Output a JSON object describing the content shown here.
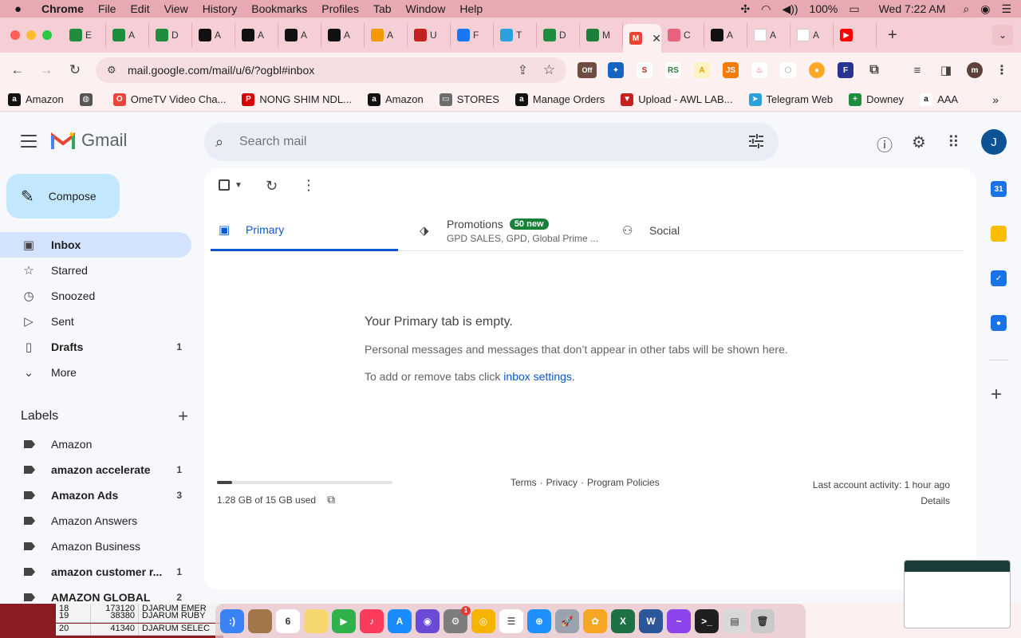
{
  "menubar": {
    "apple": "",
    "items": [
      "Chrome",
      "File",
      "Edit",
      "View",
      "History",
      "Bookmarks",
      "Profiles",
      "Tab",
      "Window",
      "Help"
    ],
    "battery": "100%",
    "clock": "Wed 7:22 AM"
  },
  "tabs": [
    {
      "label": "E",
      "color": "#1e8e3e"
    },
    {
      "label": "A",
      "color": "#1e8e3e"
    },
    {
      "label": "D",
      "color": "#1e8e3e"
    },
    {
      "label": "A",
      "color": "#111111"
    },
    {
      "label": "A",
      "color": "#111111"
    },
    {
      "label": "A",
      "color": "#111111"
    },
    {
      "label": "A",
      "color": "#111111"
    },
    {
      "label": "A",
      "color": "#f29900"
    },
    {
      "label": "U",
      "color": "#c5221f"
    },
    {
      "label": "F",
      "color": "#1877f2"
    },
    {
      "label": "T",
      "color": "#2aa1da"
    },
    {
      "label": "D",
      "color": "#1e8e3e"
    },
    {
      "label": "M",
      "color": "#188038"
    },
    {
      "label": "",
      "color": "#ea4335",
      "active": true
    },
    {
      "label": "C",
      "color": "#e8637b"
    },
    {
      "label": "A",
      "color": "#111111"
    },
    {
      "label": "A",
      "color": "#ffffff"
    },
    {
      "label": "A",
      "color": "#ffffff"
    },
    {
      "label": "",
      "color": "#ff0000"
    }
  ],
  "toolbar": {
    "url": "mail.google.com/mail/u/6/?ogbl#inbox",
    "off_badge": "Off",
    "profile_initial": "m"
  },
  "bookmarks": [
    {
      "label": "Amazon",
      "color": "#111111",
      "glyph": "a"
    },
    {
      "label": "",
      "color": "#555555",
      "glyph": "◍"
    },
    {
      "label": "OmeTV Video Cha...",
      "color": "#e8453c",
      "glyph": "O"
    },
    {
      "label": "NONG SHIM NDL...",
      "color": "#d50000",
      "glyph": "P"
    },
    {
      "label": "Amazon",
      "color": "#111111",
      "glyph": "a"
    },
    {
      "label": "STORES",
      "color": "#6d6d6d",
      "glyph": "▭"
    },
    {
      "label": "Manage Orders",
      "color": "#111111",
      "glyph": "a"
    },
    {
      "label": "Upload - AWL LAB...",
      "color": "#c5221f",
      "glyph": "▼"
    },
    {
      "label": "Telegram Web",
      "color": "#2aa1da",
      "glyph": "➤"
    },
    {
      "label": "Downey",
      "color": "#1e8e3e",
      "glyph": "+"
    },
    {
      "label": "AAA",
      "color": "#ffffff",
      "glyph": "a"
    }
  ],
  "gmail": {
    "wordmark": "Gmail",
    "search_placeholder": "Search mail",
    "avatar_initial": "J",
    "compose": "Compose",
    "nav": [
      {
        "label": "Inbox",
        "icon": "inbox-icon",
        "glyph": "▣",
        "count": "",
        "active": true
      },
      {
        "label": "Starred",
        "icon": "star-icon",
        "glyph": "☆",
        "count": ""
      },
      {
        "label": "Snoozed",
        "icon": "clock-icon",
        "glyph": "◷",
        "count": ""
      },
      {
        "label": "Sent",
        "icon": "send-icon",
        "glyph": "▷",
        "count": ""
      },
      {
        "label": "Drafts",
        "icon": "draft-icon",
        "glyph": "▯",
        "count": "1",
        "bold": true
      },
      {
        "label": "More",
        "icon": "chevron-down-icon",
        "glyph": "⌄",
        "count": ""
      }
    ],
    "labels_title": "Labels",
    "labels": [
      {
        "label": "Amazon",
        "count": "",
        "bold": false
      },
      {
        "label": "amazon accelerate",
        "count": "1",
        "bold": true
      },
      {
        "label": "Amazon Ads",
        "count": "3",
        "bold": true
      },
      {
        "label": "Amazon Answers",
        "count": "",
        "bold": false
      },
      {
        "label": "Amazon Business",
        "count": "",
        "bold": false
      },
      {
        "label": "amazon customer r...",
        "count": "1",
        "bold": true
      },
      {
        "label": "AMAZON GLOBAL",
        "count": "2",
        "bold": true
      }
    ],
    "tabs": {
      "primary": "Primary",
      "promotions": "Promotions",
      "promotions_badge": "50 new",
      "promotions_snippet": "GPD SALES, GPD, Global Prime ...",
      "social": "Social"
    },
    "empty": {
      "title": "Your Primary tab is empty.",
      "line1": "Personal messages and messages that don’t appear in other tabs will be shown here.",
      "line2_prefix": "To add or remove tabs click ",
      "line2_link": "inbox settings",
      "line2_suffix": "."
    },
    "storage": {
      "text": "1.28 GB of 15 GB used",
      "fraction": 0.085
    },
    "footer": {
      "terms": "Terms",
      "privacy": "Privacy",
      "policies": "Program Policies",
      "sep": "·"
    },
    "activity": {
      "line": "Last account activity: 1 hour ago",
      "details": "Details"
    }
  },
  "siderail": [
    {
      "name": "calendar-icon",
      "label": "31",
      "color": "#1a73e8"
    },
    {
      "name": "keep-icon",
      "label": "",
      "color": "#fbbc04"
    },
    {
      "name": "tasks-icon",
      "label": "✓",
      "color": "#1a73e8"
    },
    {
      "name": "contacts-icon",
      "label": "●",
      "color": "#1a73e8"
    }
  ],
  "sheet": {
    "rows": [
      {
        "n": "18",
        "v": "173120",
        "t": "DJARUM EMER"
      },
      {
        "n": "19",
        "v": "38380",
        "t": "DJARUM RUBY"
      },
      {
        "n": "20",
        "v": "41340",
        "t": "DJARUM SELEC"
      }
    ]
  },
  "dock": [
    {
      "name": "finder-icon",
      "color": "#3b82f6",
      "glyph": ":)"
    },
    {
      "name": "notes-book-icon",
      "color": "#a0764a",
      "glyph": ""
    },
    {
      "name": "calendar-app-icon",
      "color": "#ffffff",
      "glyph": "6"
    },
    {
      "name": "notes-icon",
      "color": "#f5d76e",
      "glyph": ""
    },
    {
      "name": "facetime-icon",
      "color": "#2fb24c",
      "glyph": "▶"
    },
    {
      "name": "music-icon",
      "color": "#fa3c5a",
      "glyph": "♪"
    },
    {
      "name": "appstore-icon",
      "color": "#1a8cff",
      "glyph": "A"
    },
    {
      "name": "siri-icon",
      "color": "#6a4bd6",
      "glyph": "◉"
    },
    {
      "name": "system-settings-icon",
      "color": "#7d7d7d",
      "glyph": "⚙"
    },
    {
      "name": "chrome-icon",
      "color": "#f4b400",
      "glyph": "◎"
    },
    {
      "name": "reminders-icon",
      "color": "#ffffff",
      "glyph": "☰"
    },
    {
      "name": "safari-icon",
      "color": "#1e90ff",
      "glyph": "⊕"
    },
    {
      "name": "launchpad-icon",
      "color": "#9aa3ad",
      "glyph": "🚀"
    },
    {
      "name": "photos-icon",
      "color": "#f6a623",
      "glyph": "✿"
    },
    {
      "name": "excel-icon",
      "color": "#1e7145",
      "glyph": "X"
    },
    {
      "name": "word-icon",
      "color": "#2b579a",
      "glyph": "W"
    },
    {
      "name": "messenger-icon",
      "color": "#8e44ec",
      "glyph": "~"
    },
    {
      "name": "terminal-icon",
      "color": "#1f1f1f",
      "glyph": ">_"
    },
    {
      "name": "archive-icon",
      "color": "#d8d8d8",
      "glyph": "▤"
    },
    {
      "name": "trash-icon",
      "color": "#c9c9c9",
      "glyph": "🗑"
    }
  ],
  "notification_badge": "1",
  "colors": {
    "accent": "#0b57d0",
    "inbox_highlight": "#d3e3fd",
    "compose": "#c2e7ff",
    "badge": "#188038"
  }
}
